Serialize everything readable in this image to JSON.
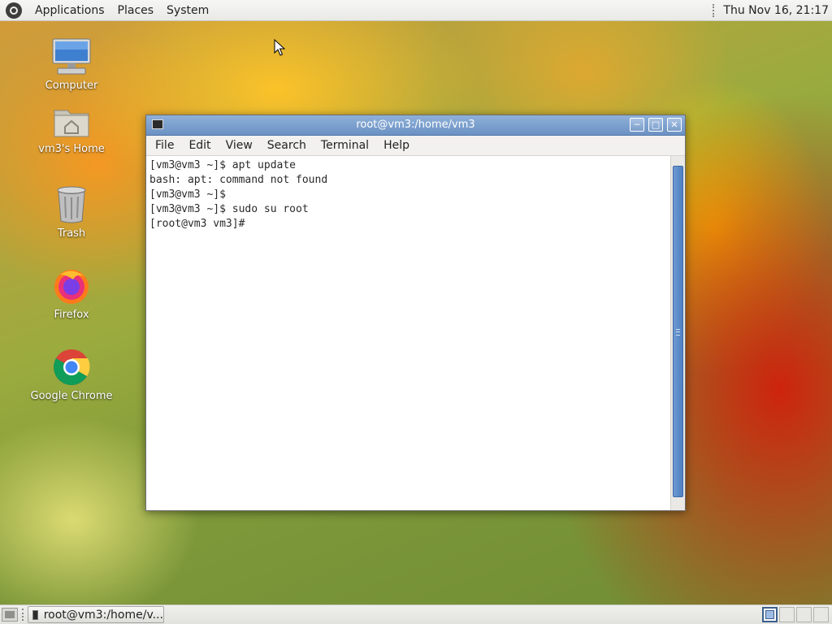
{
  "top_panel": {
    "menus": [
      "Applications",
      "Places",
      "System"
    ],
    "clock": "Thu Nov 16, 21:17"
  },
  "desktop_icons": [
    {
      "label": "Computer",
      "icon": "computer-icon"
    },
    {
      "label": "vm3's Home",
      "icon": "home-folder-icon"
    },
    {
      "label": "Trash",
      "icon": "trash-icon"
    },
    {
      "label": "Firefox",
      "icon": "firefox-icon"
    },
    {
      "label": "Google Chrome",
      "icon": "chrome-icon"
    }
  ],
  "terminal": {
    "title": "root@vm3:/home/vm3",
    "menu": [
      "File",
      "Edit",
      "View",
      "Search",
      "Terminal",
      "Help"
    ],
    "lines": [
      "[vm3@vm3 ~]$ apt update",
      "bash: apt: command not found",
      "[vm3@vm3 ~]$",
      "[vm3@vm3 ~]$ sudo su root",
      "[root@vm3 vm3]#"
    ],
    "buttons": {
      "minimize": "minimize-icon",
      "maximize": "maximize-icon",
      "close": "close-icon"
    }
  },
  "bottom_panel": {
    "task_label": "root@vm3:/home/v..."
  },
  "colors": {
    "titlebar": "#6b92c4",
    "panel": "#e9e9e6",
    "scroll_thumb": "#4f80c2"
  }
}
